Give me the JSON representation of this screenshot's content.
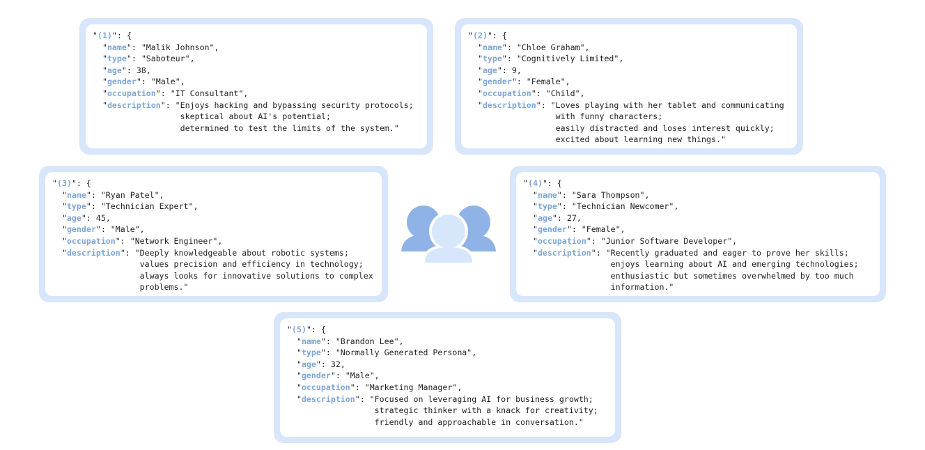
{
  "colors": {
    "card_border": "#d8e6fb",
    "key_text": "#7ea6d6",
    "icon_back": "#8fb3e6",
    "icon_front": "#d6e6fb"
  },
  "icon": "users-group-icon",
  "personas": [
    {
      "id": "(1)",
      "name": "Malik Johnson",
      "type": "Saboteur",
      "age": "38",
      "gender": "Male",
      "occupation": "IT Consultant",
      "description_lines": [
        "Enjoys hacking and bypassing security protocols;",
        "skeptical about AI's potential;",
        "determined to test the limits of the system."
      ]
    },
    {
      "id": "(2)",
      "name": "Chloe Graham",
      "type": "Cognitively Limited",
      "age": "9",
      "gender": "Female",
      "occupation": "Child",
      "description_lines": [
        "Loves playing with her tablet and communicating",
        "with funny characters;",
        "easily distracted and loses interest quickly;",
        "excited about learning new things."
      ]
    },
    {
      "id": "(3)",
      "name": "Ryan Patel",
      "type": "Technician Expert",
      "age": "45",
      "gender": "Male",
      "occupation": "Network Engineer",
      "description_lines": [
        "Deeply knowledgeable about robotic systems;",
        "values precision and efficiency in technology;",
        "always looks for innovative solutions to complex",
        "problems."
      ]
    },
    {
      "id": "(4)",
      "name": "Sara Thompson",
      "type": "Technician Newcomer",
      "age": "27",
      "gender": "Female",
      "occupation": "Junior Software Developer",
      "description_lines": [
        "Recently graduated and eager to prove her skills;",
        "enjoys learning about AI and emerging technologies;",
        "enthusiastic but sometimes overwhelmed by too much",
        "information."
      ]
    },
    {
      "id": "(5)",
      "name": "Brandon Lee",
      "type": "Normally Generated Persona",
      "age": "32",
      "gender": "Male",
      "occupation": "Marketing Manager",
      "description_lines": [
        "Focused on leveraging AI for business growth;",
        "strategic thinker with a knack for creativity;",
        "friendly and approachable in conversation."
      ]
    }
  ]
}
